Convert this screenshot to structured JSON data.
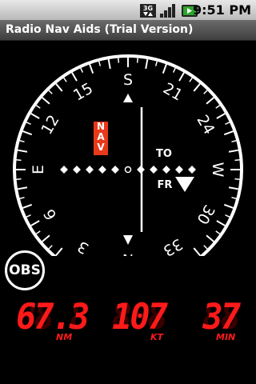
{
  "status_bar": {
    "network_type": "3G",
    "signal_icon": "signal-strength-icon",
    "battery_icon": "battery-charging-icon",
    "time": "9:51 PM"
  },
  "app": {
    "title": "Radio Nav Aids (Trial Version)"
  },
  "compass": {
    "heading_labels": [
      "S",
      "21",
      "24",
      "W",
      "30",
      "33",
      "N",
      "3",
      "6",
      "E",
      "12",
      "15"
    ],
    "nav_flag": "NAV",
    "to_label": "TO",
    "from_label": "FR",
    "to_from_state": "FR",
    "cdi_deviation_dots": 0
  },
  "obs": {
    "label": "OBS"
  },
  "readouts": [
    {
      "value": "67.3",
      "unit": "NM"
    },
    {
      "value": "107",
      "unit": "KT"
    },
    {
      "value": "37",
      "unit": "MIN"
    }
  ],
  "colors": {
    "background": "#000000",
    "dial": "#ffffff",
    "nav_flag": "#e8391a",
    "readout": "#ff1a1a"
  }
}
